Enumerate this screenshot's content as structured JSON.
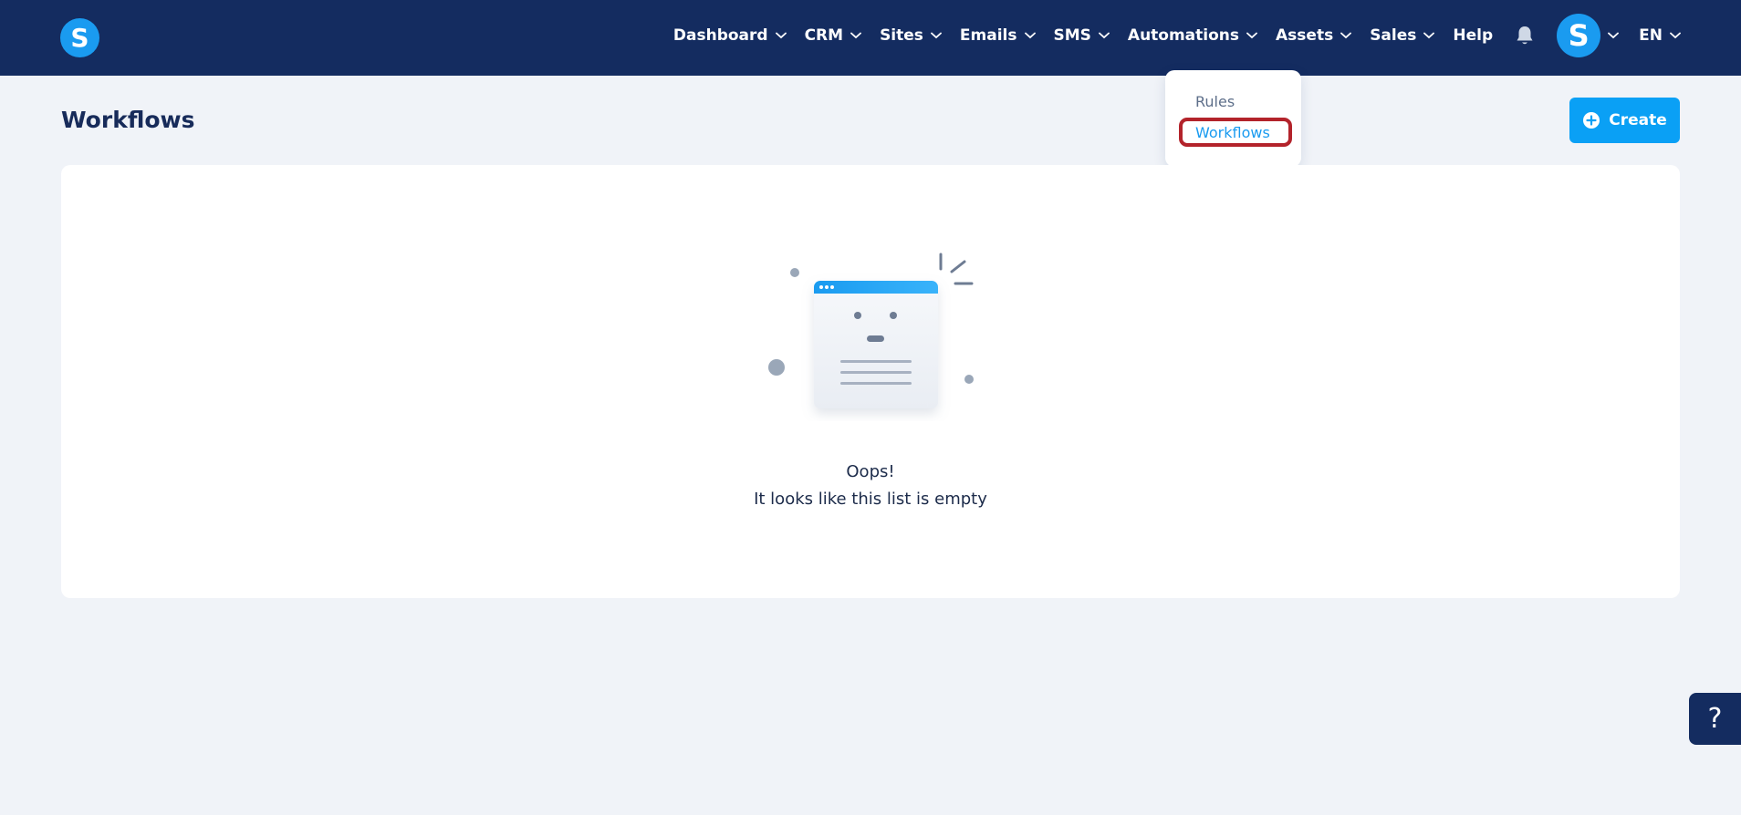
{
  "app": {
    "logo_letter": "S"
  },
  "nav": {
    "items": [
      {
        "label": "Dashboard"
      },
      {
        "label": "CRM"
      },
      {
        "label": "Sites"
      },
      {
        "label": "Emails"
      },
      {
        "label": "SMS"
      },
      {
        "label": "Automations"
      },
      {
        "label": "Assets"
      },
      {
        "label": "Sales"
      }
    ],
    "help_label": "Help",
    "avatar_letter": "S",
    "language": "EN"
  },
  "automations_menu": {
    "items": [
      {
        "label": "Rules"
      },
      {
        "label": "Workflows"
      }
    ]
  },
  "page": {
    "title": "Workflows",
    "create_label": "Create"
  },
  "empty_state": {
    "title": "Oops!",
    "message": "It looks like this list is empty"
  },
  "help_widget": {
    "symbol": "?"
  },
  "colors": {
    "nav_bg": "#142c60",
    "accent": "#0aa0f5",
    "page_bg": "#f0f3f8",
    "highlight": "#b3232b"
  }
}
